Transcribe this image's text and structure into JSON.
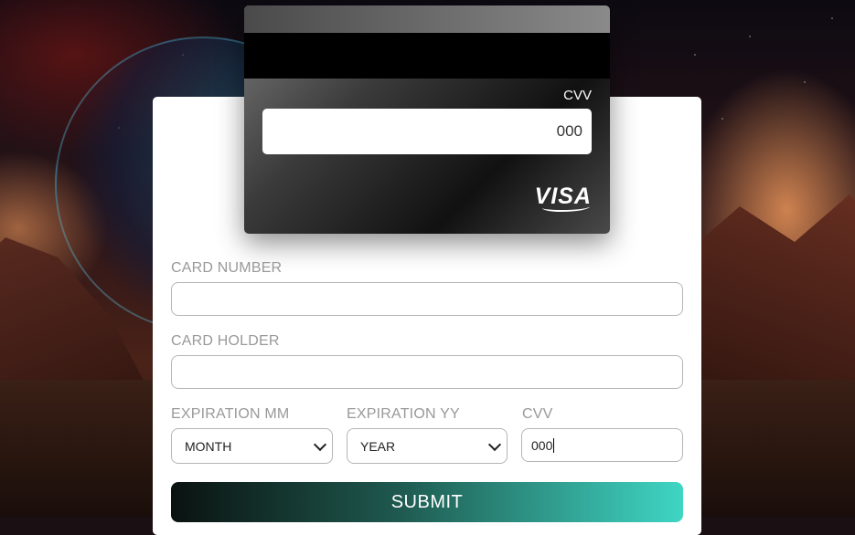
{
  "card": {
    "cvv_label": "CVV",
    "cvv_value": "000",
    "brand": "VISA"
  },
  "form": {
    "card_number_label": "CARD NUMBER",
    "card_number_value": "",
    "card_holder_label": "CARD HOLDER",
    "card_holder_value": "",
    "exp_mm_label": "EXPIRATION MM",
    "exp_mm_selected": "MONTH",
    "exp_yy_label": "EXPIRATION YY",
    "exp_yy_selected": "YEAR",
    "cvv_label": "CVV",
    "cvv_value": "000",
    "submit_label": "SUBMIT"
  },
  "colors": {
    "submit_start": "#0a1210",
    "submit_end": "#3fd6c4",
    "label": "#999999"
  }
}
